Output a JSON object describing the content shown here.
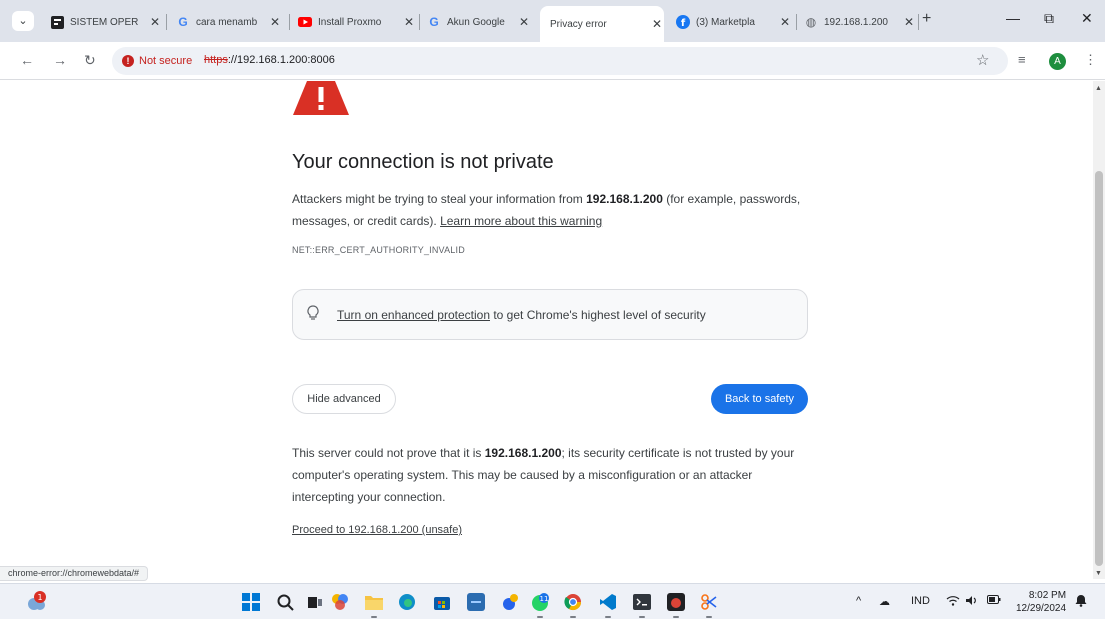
{
  "tabs": [
    {
      "title": "SISTEM OPER",
      "icon": "app-icon"
    },
    {
      "title": "cara menamb",
      "icon": "google-icon"
    },
    {
      "title": "Install Proxmo",
      "icon": "youtube-icon"
    },
    {
      "title": "Akun Google",
      "icon": "google-icon"
    },
    {
      "title": "Privacy error",
      "icon": "",
      "active": true
    },
    {
      "title": "(3) Marketpla",
      "icon": "facebook-icon"
    },
    {
      "title": "192.168.1.200",
      "icon": "globe-icon"
    }
  ],
  "window_controls": {
    "minimize": "—",
    "restore": "⧉",
    "close": "✕"
  },
  "toolbar": {
    "not_secure": "Not secure",
    "url_scheme": "https",
    "url_rest": "://192.168.1.200:8006"
  },
  "page": {
    "heading": "Your connection is not private",
    "para1_a": "Attackers might be trying to steal your information from ",
    "host": "192.168.1.200",
    "para1_b": " (for example, passwords, messages, or credit cards). ",
    "learn_more": "Learn more about this warning",
    "error_code": "NET::ERR_CERT_AUTHORITY_INVALID",
    "protection_link": "Turn on enhanced protection",
    "protection_rest": " to get Chrome's highest level of security",
    "hide_advanced": "Hide advanced",
    "back_to_safety": "Back to safety",
    "para2_a": "This server could not prove that it is ",
    "para2_b": "; its security certificate is not trusted by your computer's operating system. This may be caused by a misconfiguration or an attacker intercepting your connection.",
    "proceed": "Proceed to 192.168.1.200 (unsafe)"
  },
  "status_text": "chrome-error://chromewebdata/#",
  "taskbar": {
    "weather_badge": "1",
    "chrome_badge": "11",
    "tray_lang": "IND",
    "time": "8:02 PM",
    "date": "12/29/2024"
  },
  "colors": {
    "accent": "#1a73e8",
    "danger": "#c5221f",
    "warning_triangle": "#d93025"
  }
}
